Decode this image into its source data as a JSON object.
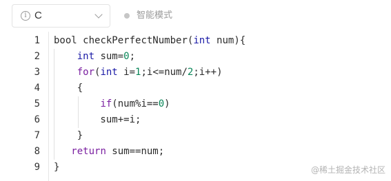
{
  "toolbar": {
    "language_value": "C",
    "info_icon": "info-circle-icon",
    "dropdown_icon": "chevron-down-icon",
    "mode_label": "智能模式"
  },
  "editor": {
    "lines": [
      {
        "number": "1",
        "tokens": [
          {
            "t": "bool ",
            "c": "plain"
          },
          {
            "t": "checkPerfectNumber",
            "c": "fn"
          },
          {
            "t": "(",
            "c": "plain"
          },
          {
            "t": "int",
            "c": "type"
          },
          {
            "t": " num){",
            "c": "plain"
          }
        ]
      },
      {
        "number": "2",
        "tokens": [
          {
            "t": "    ",
            "c": "plain"
          },
          {
            "t": "int",
            "c": "type"
          },
          {
            "t": " sum=",
            "c": "plain"
          },
          {
            "t": "0",
            "c": "num"
          },
          {
            "t": ";",
            "c": "plain"
          }
        ]
      },
      {
        "number": "3",
        "tokens": [
          {
            "t": "    ",
            "c": "plain"
          },
          {
            "t": "for",
            "c": "kw"
          },
          {
            "t": "(",
            "c": "plain"
          },
          {
            "t": "int",
            "c": "type"
          },
          {
            "t": " i=",
            "c": "plain"
          },
          {
            "t": "1",
            "c": "num"
          },
          {
            "t": ";i<=num/",
            "c": "plain"
          },
          {
            "t": "2",
            "c": "num"
          },
          {
            "t": ";i++)",
            "c": "plain"
          }
        ]
      },
      {
        "number": "4",
        "tokens": [
          {
            "t": "    {",
            "c": "plain"
          }
        ]
      },
      {
        "number": "5",
        "tokens": [
          {
            "t": "        ",
            "c": "plain"
          },
          {
            "t": "if",
            "c": "kw"
          },
          {
            "t": "(num%i==",
            "c": "plain"
          },
          {
            "t": "0",
            "c": "num"
          },
          {
            "t": ")",
            "c": "plain"
          }
        ]
      },
      {
        "number": "6",
        "tokens": [
          {
            "t": "        sum+=i;",
            "c": "plain"
          }
        ]
      },
      {
        "number": "7",
        "tokens": [
          {
            "t": "    }",
            "c": "plain"
          }
        ]
      },
      {
        "number": "8",
        "tokens": [
          {
            "t": "   ",
            "c": "plain"
          },
          {
            "t": "return",
            "c": "kw"
          },
          {
            "t": " sum==num;",
            "c": "plain"
          }
        ]
      },
      {
        "number": "9",
        "tokens": [
          {
            "t": "}",
            "c": "plain"
          }
        ]
      }
    ]
  },
  "watermark": "@稀土掘金技术社区",
  "colors": {
    "keyword": "#7a1fa0",
    "type": "#1a1aa6",
    "number": "#098658",
    "text": "#2b2b2b"
  }
}
